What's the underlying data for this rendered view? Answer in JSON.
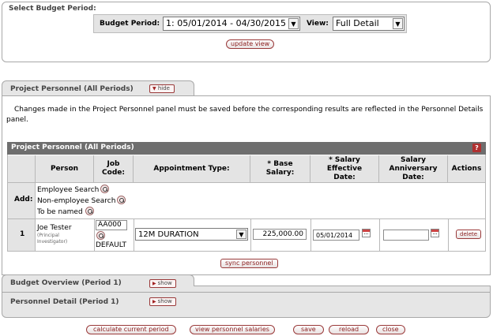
{
  "budget_period_section": {
    "title": "Select Budget Period:",
    "budget_period_label": "Budget Period:",
    "budget_period_value": "1: 05/01/2014 - 04/30/2015",
    "view_label": "View:",
    "view_value": "Full Detail",
    "update_view_label": "update view"
  },
  "project_personnel": {
    "tab_title": "Project Personnel (All Periods)",
    "hide_label": "hide",
    "notice": "Changes made in the Project Personnel panel must be saved before the corresponding results are reflected in the Personnel Details panel.",
    "table_title": "Project Personnel (All Periods)",
    "help_label": "?",
    "columns": {
      "person": "Person",
      "job_code_1": "Job",
      "job_code_2": "Code:",
      "appointment_type": "Appointment Type:",
      "base_salary_1": "* Base",
      "base_salary_2": "Salary:",
      "salary_effective_1": "* Salary",
      "salary_effective_2": "Effective",
      "salary_effective_3": "Date:",
      "salary_anniversary_1": "Salary",
      "salary_anniversary_2": "Anniversary",
      "salary_anniversary_3": "Date:",
      "actions": "Actions"
    },
    "add_row": {
      "label": "Add:",
      "employee_search": "Employee Search",
      "non_employee_search": "Non-employee Search",
      "to_be_named": "To be named"
    },
    "rows": [
      {
        "number": "1",
        "person_name": "Joe Tester",
        "person_role_1": "(Principal",
        "person_role_2": "Investigator)",
        "job_code": "AA000",
        "job_code_default": "DEFAULT",
        "appointment_type": "12M DURATION",
        "base_salary": "225,000.00",
        "salary_effective_date": "05/01/2014",
        "salary_anniversary_date": "",
        "delete_label": "delete"
      }
    ],
    "sync_label": "sync personnel"
  },
  "collapsed_tabs": {
    "budget_overview": "Budget Overview (Period 1)",
    "personnel_detail": "Personnel Detail (Period 1)",
    "show_label": "show"
  },
  "footer_buttons": {
    "calculate": "calculate current period",
    "view_salaries": "view personnel salaries",
    "save": "save",
    "reload": "reload",
    "close": "close"
  },
  "colors": {
    "table_header_bar": "#6e6e6e",
    "button_text": "#8a1d1d",
    "header_gray": "#e4e4e4"
  }
}
